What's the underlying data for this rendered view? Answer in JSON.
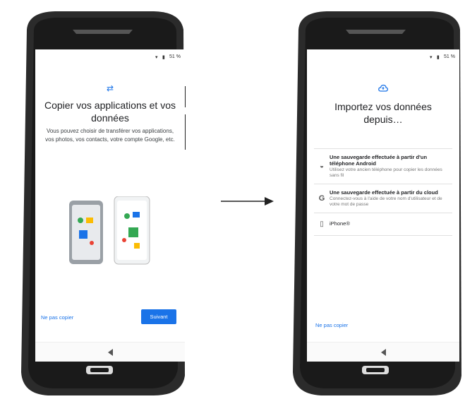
{
  "left_screen": {
    "status": "51 %",
    "title": "Copier vos applications et vos données",
    "description": "Vous pouvez choisir de transférer vos applications, vos photos, vos contacts, votre compte Google, etc.",
    "skip_label": "Ne pas copier",
    "next_label": "Suivant"
  },
  "right_screen": {
    "status": "51 %",
    "title": "Importez vos données depuis…",
    "options": [
      {
        "icon": "android-icon",
        "title": "Une sauvegarde effectuée à partir d'un téléphone Android",
        "subtitle": "Utilisez votre ancien téléphone pour copier les données sans fil"
      },
      {
        "icon": "google-icon",
        "title": "Une sauvegarde effectuée à partir du cloud",
        "subtitle": "Connectez-vous à l'aide de votre nom d'utilisateur et de votre mot de passe"
      },
      {
        "icon": "phone-icon",
        "title": "iPhone®",
        "subtitle": ""
      }
    ],
    "skip_label": "Ne pas copier"
  },
  "colors": {
    "accent": "#1a73e8",
    "phone_body": "#2b2b2b"
  }
}
